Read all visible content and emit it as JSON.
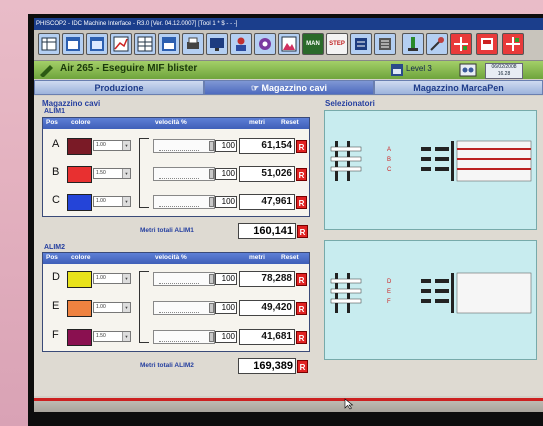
{
  "window": {
    "title": "PHISCOP2 - IDC Machine Interface - R3.0 [Ver. 04.12.0007] [Tool 1 * $ - - -]"
  },
  "toolbar": {
    "man_label": "MAN",
    "step_label": "STEP"
  },
  "status": {
    "title": "Air 265 - Eseguire MIF blister",
    "level": "Level 3",
    "date": "06/02/2008",
    "time": "16.28"
  },
  "tabs": [
    "Produzione",
    "Magazzino cavi",
    "Magazzino MarcaPen"
  ],
  "magazzino": {
    "title": "Magazzino cavi",
    "alim1": {
      "label": "ALIM1",
      "headers": {
        "pos": "Pos",
        "colore": "colore",
        "velocita": "velocità %",
        "metri": "metri",
        "reset": "Reset"
      },
      "rows": [
        {
          "pos": "A",
          "color": "#7a1a26",
          "spin": "1.00",
          "vel": "100",
          "metri": "61,154",
          "reset": "R"
        },
        {
          "pos": "B",
          "color": "#e83030",
          "spin": "1.50",
          "vel": "100",
          "metri": "51,026",
          "reset": "R"
        },
        {
          "pos": "C",
          "color": "#2444d8",
          "spin": "1.00",
          "vel": "100",
          "metri": "47,961",
          "reset": "R"
        }
      ],
      "total_label": "Metri totali ALIM1",
      "total": "160,141",
      "total_reset": "R"
    },
    "alim2": {
      "label": "ALIM2",
      "headers": {
        "pos": "Pos",
        "colore": "colore",
        "velocita": "velocità %",
        "metri": "metri",
        "reset": "Reset"
      },
      "rows": [
        {
          "pos": "D",
          "color": "#e8e21a",
          "spin": "1.00",
          "vel": "100",
          "metri": "78,288",
          "reset": "R"
        },
        {
          "pos": "E",
          "color": "#ee8240",
          "spin": "1.00",
          "vel": "100",
          "metri": "49,420",
          "reset": "R"
        },
        {
          "pos": "F",
          "color": "#8a1050",
          "spin": "1.50",
          "vel": "100",
          "metri": "41,681",
          "reset": "R"
        }
      ],
      "total_label": "Metri totali ALIM2",
      "total": "169,389",
      "total_reset": "R"
    }
  },
  "selezionatori": {
    "title": "Selezionatori",
    "top_letters": [
      "A",
      "B",
      "C"
    ],
    "bottom_letters": [
      "D",
      "E",
      "F"
    ]
  },
  "colors": {
    "accent": "#3f5fb8",
    "status_green": "#6fa43c",
    "reset_red": "#e02222",
    "panel_cyan": "#c8ecef"
  },
  "icons": [
    "grid-icon",
    "window-icon",
    "window-icon",
    "chart-icon",
    "grid-icon",
    "window-icon",
    "printer-icon",
    "monitor-icon",
    "person-icon",
    "settings-icon",
    "image-icon",
    "man-button",
    "step-button",
    "list-icon",
    "list-icon",
    "person-icon",
    "tools-icon",
    "red-grid-icon",
    "red-box-icon",
    "red-grid-icon"
  ]
}
